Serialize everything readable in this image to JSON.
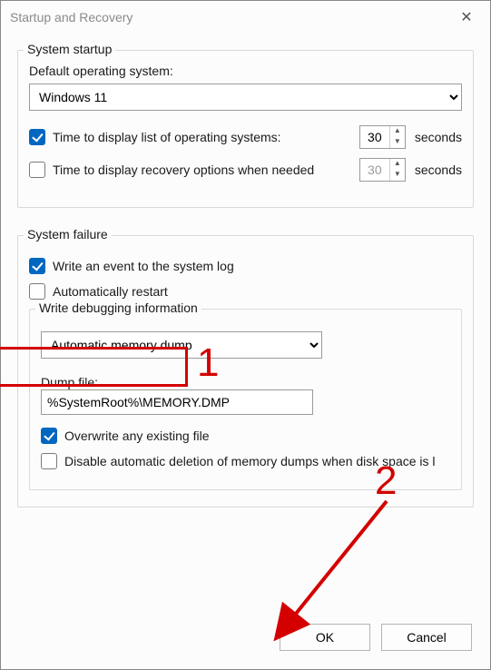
{
  "window": {
    "title": "Startup and Recovery",
    "close_glyph": "✕"
  },
  "startup_group": {
    "label": "System startup",
    "default_os_label": "Default operating system:",
    "default_os_value": "Windows 11",
    "display_os_list": {
      "checked": true,
      "label": "Time to display list of operating systems:",
      "value": "30",
      "unit": "seconds"
    },
    "display_recovery": {
      "checked": false,
      "label": "Time to display recovery options when needed",
      "value": "30",
      "unit": "seconds"
    }
  },
  "failure_group": {
    "label": "System failure",
    "write_event": {
      "checked": true,
      "label": "Write an event to the system log"
    },
    "auto_restart": {
      "checked": false,
      "label": "Automatically restart"
    },
    "debug_sub": {
      "label": "Write debugging information",
      "select_value": "Automatic memory dump",
      "dump_label": "Dump file:",
      "dump_value": "%SystemRoot%\\MEMORY.DMP",
      "overwrite": {
        "checked": true,
        "label": "Overwrite any existing file"
      },
      "disable_del": {
        "checked": false,
        "label": "Disable automatic deletion of memory dumps when disk space is l"
      }
    }
  },
  "buttons": {
    "ok": "OK",
    "cancel": "Cancel"
  },
  "annotations": {
    "n1": "1",
    "n2": "2"
  }
}
